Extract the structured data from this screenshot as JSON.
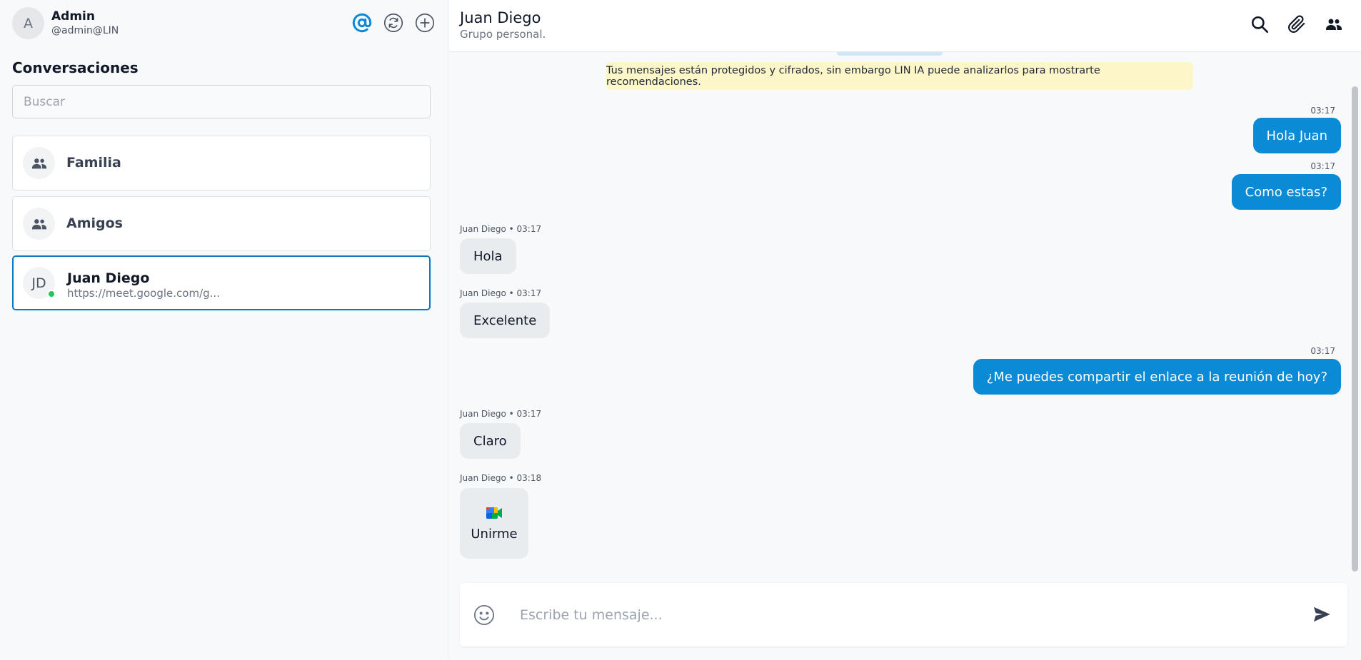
{
  "sidebar": {
    "user": {
      "avatar_initial": "A",
      "name": "Admin",
      "handle": "@admin@LIN"
    },
    "header_icons": [
      "at-sign-icon",
      "refresh-icon",
      "plus-circle-icon"
    ],
    "title": "Conversaciones",
    "search": {
      "placeholder": "Buscar",
      "value": ""
    },
    "conversations": [
      {
        "name": "Familia",
        "type": "group",
        "icon": "group-icon"
      },
      {
        "name": "Amigos",
        "type": "group",
        "icon": "group-icon"
      },
      {
        "name": "Juan Diego",
        "initials": "JD",
        "preview": "https://meet.google.com/g...",
        "online": true,
        "active": true
      }
    ]
  },
  "chat": {
    "header": {
      "name": "Juan Diego",
      "subtitle": "Grupo personal.",
      "icons": [
        "search-icon",
        "paperclip-icon",
        "people-icon"
      ]
    },
    "notice": "Tus mensajes están protegidos y cifrados, sin embargo LIN IA puede analizarlos para mostrarte recomendaciones.",
    "messages": [
      {
        "direction": "out",
        "time": "03:17",
        "text": "Hola Juan"
      },
      {
        "direction": "out",
        "time": "03:17",
        "text": "Como estas?"
      },
      {
        "direction": "in",
        "meta": "Juan Diego • 03:17",
        "text": "Hola"
      },
      {
        "direction": "in",
        "meta": "Juan Diego • 03:17",
        "text": "Excelente"
      },
      {
        "direction": "out",
        "time": "03:17",
        "text": "¿Me puedes compartir el enlace a la reunión de hoy?"
      },
      {
        "direction": "in",
        "meta": "Juan Diego • 03:17",
        "text": "Claro"
      },
      {
        "direction": "in",
        "meta": "Juan Diego • 03:18",
        "type": "meet-link",
        "icon": "google-meet-icon",
        "text": "Unirme"
      }
    ],
    "composer": {
      "placeholder": "Escribe tu mensaje...",
      "value": "",
      "emoji_icon": "smiley-icon",
      "send_icon": "send-icon"
    }
  },
  "colors": {
    "accent": "#0b8ad6",
    "active_border": "#0b78c4",
    "online": "#22c55e",
    "notice_bg": "#fdf6c8",
    "incoming_bg": "#e9ecef"
  }
}
